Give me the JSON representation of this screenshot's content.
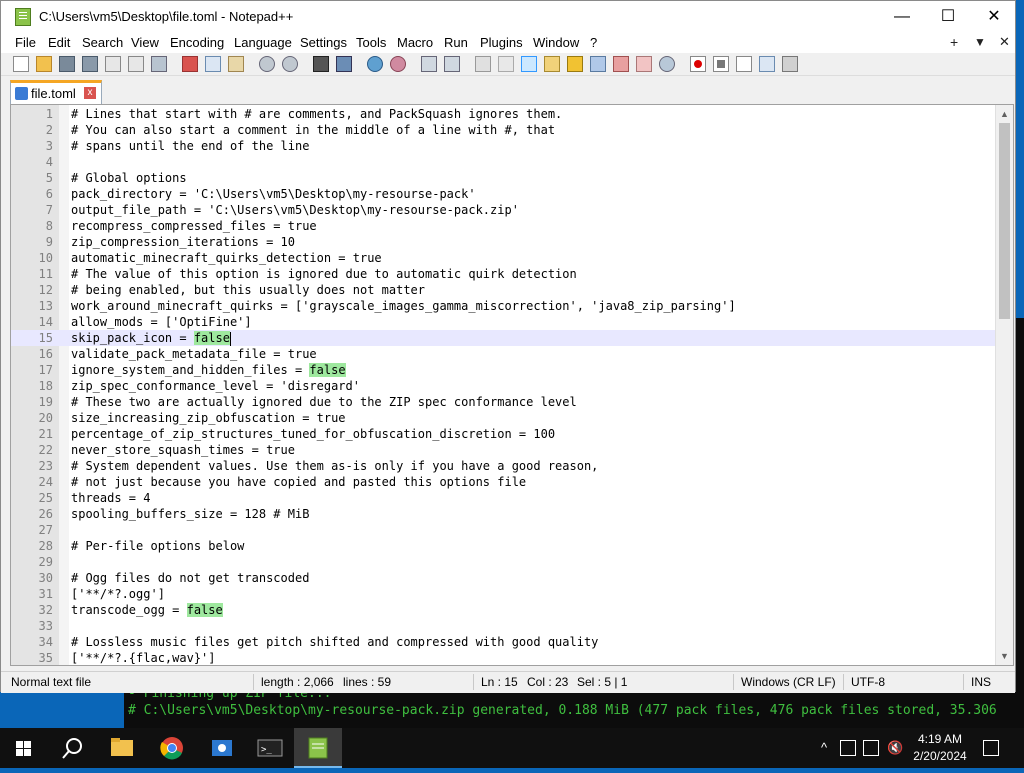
{
  "window": {
    "title": "C:\\Users\\vm5\\Desktop\\file.toml - Notepad++",
    "minimize": "—",
    "maximize": "☐",
    "close": "✕"
  },
  "menu": [
    "File",
    "Edit",
    "Search",
    "View",
    "Encoding",
    "Language",
    "Settings",
    "Tools",
    "Macro",
    "Run",
    "Plugins",
    "Window",
    "?"
  ],
  "menu_right": {
    "plus": "+",
    "dropdown": "▼",
    "close": "✕"
  },
  "tab": {
    "label": "file.toml",
    "close": "x"
  },
  "editor": {
    "current_line": 15,
    "lines": [
      {
        "n": "1",
        "text": "# Lines that start with # are comments, and PackSquash ignores them."
      },
      {
        "n": "2",
        "text": "# You can also start a comment in the middle of a line with #, that"
      },
      {
        "n": "3",
        "text": "# spans until the end of the line"
      },
      {
        "n": "4",
        "text": ""
      },
      {
        "n": "5",
        "text": "# Global options"
      },
      {
        "n": "6",
        "text": "pack_directory = 'C:\\Users\\vm5\\Desktop\\my-resourse-pack'"
      },
      {
        "n": "7",
        "text": "output_file_path = 'C:\\Users\\vm5\\Desktop\\my-resourse-pack.zip'"
      },
      {
        "n": "8",
        "text": "recompress_compressed_files = true"
      },
      {
        "n": "9",
        "text": "zip_compression_iterations = 10"
      },
      {
        "n": "10",
        "text": "automatic_minecraft_quirks_detection = true"
      },
      {
        "n": "11",
        "text": "# The value of this option is ignored due to automatic quirk detection"
      },
      {
        "n": "12",
        "text": "# being enabled, but this usually does not matter"
      },
      {
        "n": "13",
        "text": "work_around_minecraft_quirks = ['grayscale_images_gamma_miscorrection', 'java8_zip_parsing']"
      },
      {
        "n": "14",
        "text": "allow_mods = ['OptiFine']"
      },
      {
        "n": "15",
        "pre": "skip_pack_icon = ",
        "hl": "false",
        "post": ""
      },
      {
        "n": "16",
        "text": "validate_pack_metadata_file = true"
      },
      {
        "n": "17",
        "pre": "ignore_system_and_hidden_files = ",
        "hl": "false",
        "post": ""
      },
      {
        "n": "18",
        "text": "zip_spec_conformance_level = 'disregard'"
      },
      {
        "n": "19",
        "text": "# These two are actually ignored due to the ZIP spec conformance level"
      },
      {
        "n": "20",
        "text": "size_increasing_zip_obfuscation = true"
      },
      {
        "n": "21",
        "text": "percentage_of_zip_structures_tuned_for_obfuscation_discretion = 100"
      },
      {
        "n": "22",
        "text": "never_store_squash_times = true"
      },
      {
        "n": "23",
        "text": "# System dependent values. Use them as-is only if you have a good reason,"
      },
      {
        "n": "24",
        "text": "# not just because you have copied and pasted this options file"
      },
      {
        "n": "25",
        "text": "threads = 4"
      },
      {
        "n": "26",
        "text": "spooling_buffers_size = 128 # MiB"
      },
      {
        "n": "27",
        "text": ""
      },
      {
        "n": "28",
        "text": "# Per-file options below"
      },
      {
        "n": "29",
        "text": ""
      },
      {
        "n": "30",
        "text": "# Ogg files do not get transcoded"
      },
      {
        "n": "31",
        "text": "['**/*?.ogg']"
      },
      {
        "n": "32",
        "pre": "transcode_ogg = ",
        "hl": "false",
        "post": ""
      },
      {
        "n": "33",
        "text": ""
      },
      {
        "n": "34",
        "text": "# Lossless music files get pitch shifted and compressed with good quality"
      },
      {
        "n": "35",
        "text": "['**/*?.{flac,wav}']"
      }
    ]
  },
  "status": {
    "type": "Normal text file",
    "length": "length : 2,066",
    "lines": "lines : 59",
    "ln": "Ln : 15",
    "col": "Col : 23",
    "sel": "Sel : 5 | 1",
    "eol": "Windows (CR LF)",
    "encoding": "UTF-8",
    "mode": "INS"
  },
  "console": {
    "line1": "- Finishing up ZIP file...",
    "line2": "# C:\\Users\\vm5\\Desktop\\my-resourse-pack.zip generated, 0.188 MiB (477 pack files, 476 pack files stored, 35.306"
  },
  "taskbar": {
    "time": "4:19 AM",
    "date": "2/20/2024"
  },
  "colors": {
    "highlight": "#9ee89e",
    "current_line": "#e8e8ff",
    "tab_accent": "#f5a623",
    "console_text": "#3fbf3f",
    "taskbar": "#101010"
  }
}
